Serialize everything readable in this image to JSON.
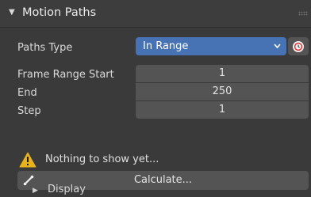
{
  "panel": {
    "title": "Motion Paths",
    "expand_icon": "triangle-down-icon",
    "grip_icon": "drag-grip-icon"
  },
  "paths_type": {
    "label": "Paths Type",
    "value": "In Range",
    "chevron_icon": "chevron-down-icon",
    "clock_icon": "clock-icon"
  },
  "frame_range": {
    "start_label": "Frame Range Start",
    "start_value": "1",
    "end_label": "End",
    "end_value": "250",
    "step_label": "Step",
    "step_value": "1"
  },
  "warning": {
    "icon": "warning-icon",
    "text": "Nothing to show yet..."
  },
  "calculate": {
    "label": "Calculate...",
    "icon": "bone-icon"
  },
  "display_subpanel": {
    "title": "Display",
    "expand_icon": "triangle-right-icon"
  },
  "colors": {
    "background": "#3a3a3a",
    "field": "#545454",
    "accent": "#4772b3",
    "warning": "#e8b31a"
  }
}
